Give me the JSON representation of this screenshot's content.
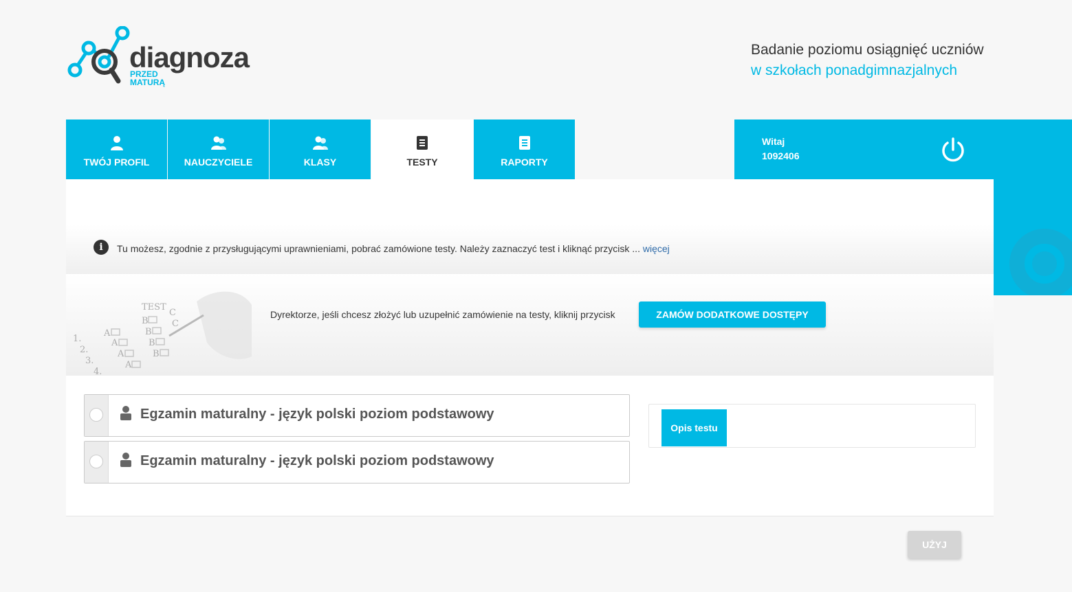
{
  "logo": {
    "word": "diagnoza",
    "sub_line1": "PRZED",
    "sub_line2": "MATURĄ"
  },
  "tagline": {
    "line1": "Badanie poziomu osiągnięć uczniów",
    "line2": "w szkołach ponadgimnazjalnych"
  },
  "nav": {
    "tabs": [
      {
        "label": "TWÓJ PROFIL",
        "icon": "user-icon",
        "active": false
      },
      {
        "label": "NAUCZYCIELE",
        "icon": "users-icon",
        "active": false
      },
      {
        "label": "KLASY",
        "icon": "users-icon",
        "active": false
      },
      {
        "label": "TESTY",
        "icon": "document-icon",
        "active": true
      },
      {
        "label": "RAPORTY",
        "icon": "report-icon",
        "active": false
      }
    ]
  },
  "user": {
    "greeting": "Witaj",
    "id": "1092406",
    "logout_icon": "power-icon"
  },
  "info": {
    "text": "Tu możesz, zgodnie z przysługującymi uprawnieniami, pobrać zamówione testy. Należy zaznaczyć test i kliknąć przycisk ...",
    "more": "więcej"
  },
  "order": {
    "text": "Dyrektorze, jeśli chcesz złożyć lub uzupełnić zamówienie na testy, kliknij przycisk",
    "button": "ZAMÓW DODATKOWE DOSTĘPY"
  },
  "tests": [
    {
      "title": "Egzamin maturalny - język polski poziom podstawowy",
      "selected": false
    },
    {
      "title": "Egzamin maturalny - język polski poziom podstawowy",
      "selected": false
    }
  ],
  "description": {
    "tab_label": "Opis testu"
  },
  "footer": {
    "use_button": "UŻYJ"
  },
  "colors": {
    "accent": "#00b9e4",
    "disabled": "#d5d5d5",
    "link": "#2d6aa8"
  }
}
